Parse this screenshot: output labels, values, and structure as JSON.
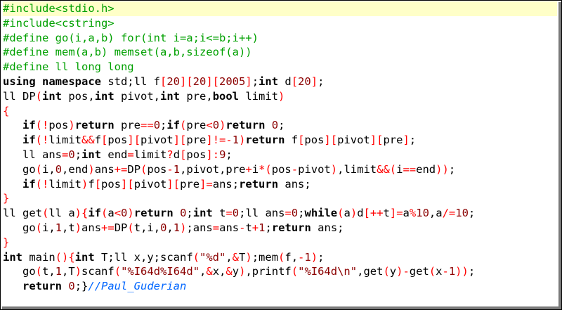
{
  "colors": {
    "preprocessor": "#00a000",
    "keyword": "#000000",
    "operator": "#ff0000",
    "number": "#8b0000",
    "string": "#8b0000",
    "comment": "#0066ff",
    "current_line": "#ffffc8"
  },
  "code": {
    "current_line_index": 0,
    "lines": [
      [
        [
          "pp",
          "#include<stdio.h>"
        ]
      ],
      [
        [
          "pp",
          "#include<cstring>"
        ]
      ],
      [
        [
          "pp",
          "#define go(i,a,b) for(int i=a;i<=b;i++)"
        ]
      ],
      [
        [
          "pp",
          "#define mem(a,b) memset(a,b,sizeof(a))"
        ]
      ],
      [
        [
          "pp",
          "#define ll long long"
        ]
      ],
      [
        [
          "kw",
          "using namespace"
        ],
        [
          "id",
          " std;ll f"
        ],
        [
          "op",
          "["
        ],
        [
          "num",
          "20"
        ],
        [
          "op",
          "]["
        ],
        [
          "num",
          "20"
        ],
        [
          "op",
          "]["
        ],
        [
          "num",
          "2005"
        ],
        [
          "op",
          "]"
        ],
        [
          "id",
          ";"
        ],
        [
          "kw",
          "int"
        ],
        [
          "id",
          " d"
        ],
        [
          "op",
          "["
        ],
        [
          "num",
          "20"
        ],
        [
          "op",
          "]"
        ],
        [
          "id",
          ";"
        ]
      ],
      [
        [
          "id",
          "ll DP"
        ],
        [
          "op",
          "("
        ],
        [
          "kw",
          "int"
        ],
        [
          "id",
          " pos,"
        ],
        [
          "kw",
          "int"
        ],
        [
          "id",
          " pivot,"
        ],
        [
          "kw",
          "int"
        ],
        [
          "id",
          " pre,"
        ],
        [
          "kw",
          "bool"
        ],
        [
          "id",
          " limit"
        ],
        [
          "op",
          ")"
        ]
      ],
      [
        [
          "op",
          "{"
        ]
      ],
      [
        [
          "id",
          "   "
        ],
        [
          "kw",
          "if"
        ],
        [
          "op",
          "(!"
        ],
        [
          "id",
          "pos"
        ],
        [
          "op",
          ")"
        ],
        [
          "kw",
          "return"
        ],
        [
          "id",
          " pre"
        ],
        [
          "op",
          "=="
        ],
        [
          "num",
          "0"
        ],
        [
          "id",
          ";"
        ],
        [
          "kw",
          "if"
        ],
        [
          "op",
          "("
        ],
        [
          "id",
          "pre"
        ],
        [
          "op",
          "<"
        ],
        [
          "num",
          "0"
        ],
        [
          "op",
          ")"
        ],
        [
          "kw",
          "return"
        ],
        [
          "id",
          " "
        ],
        [
          "num",
          "0"
        ],
        [
          "id",
          ";"
        ]
      ],
      [
        [
          "id",
          "   "
        ],
        [
          "kw",
          "if"
        ],
        [
          "op",
          "(!"
        ],
        [
          "id",
          "limit"
        ],
        [
          "op",
          "&&"
        ],
        [
          "id",
          "f"
        ],
        [
          "op",
          "["
        ],
        [
          "id",
          "pos"
        ],
        [
          "op",
          "]["
        ],
        [
          "id",
          "pivot"
        ],
        [
          "op",
          "]["
        ],
        [
          "id",
          "pre"
        ],
        [
          "op",
          "]!=-"
        ],
        [
          "num",
          "1"
        ],
        [
          "op",
          ")"
        ],
        [
          "kw",
          "return"
        ],
        [
          "id",
          " f"
        ],
        [
          "op",
          "["
        ],
        [
          "id",
          "pos"
        ],
        [
          "op",
          "]["
        ],
        [
          "id",
          "pivot"
        ],
        [
          "op",
          "]["
        ],
        [
          "id",
          "pre"
        ],
        [
          "op",
          "]"
        ],
        [
          "id",
          ";"
        ]
      ],
      [
        [
          "id",
          "   ll ans"
        ],
        [
          "op",
          "="
        ],
        [
          "num",
          "0"
        ],
        [
          "id",
          ";"
        ],
        [
          "kw",
          "int"
        ],
        [
          "id",
          " end"
        ],
        [
          "op",
          "="
        ],
        [
          "id",
          "limit"
        ],
        [
          "op",
          "?"
        ],
        [
          "id",
          "d"
        ],
        [
          "op",
          "["
        ],
        [
          "id",
          "pos"
        ],
        [
          "op",
          "]:"
        ],
        [
          "num",
          "9"
        ],
        [
          "id",
          ";"
        ]
      ],
      [
        [
          "id",
          "   go"
        ],
        [
          "op",
          "("
        ],
        [
          "id",
          "i,"
        ],
        [
          "num",
          "0"
        ],
        [
          "id",
          ",end"
        ],
        [
          "op",
          ")"
        ],
        [
          "id",
          "ans"
        ],
        [
          "op",
          "+="
        ],
        [
          "id",
          "DP"
        ],
        [
          "op",
          "("
        ],
        [
          "id",
          "pos"
        ],
        [
          "op",
          "-"
        ],
        [
          "num",
          "1"
        ],
        [
          "id",
          ",pivot,pre"
        ],
        [
          "op",
          "+"
        ],
        [
          "id",
          "i"
        ],
        [
          "op",
          "*("
        ],
        [
          "id",
          "pos"
        ],
        [
          "op",
          "-"
        ],
        [
          "id",
          "pivot"
        ],
        [
          "op",
          ")"
        ],
        [
          "id",
          ",limit"
        ],
        [
          "op",
          "&&("
        ],
        [
          "id",
          "i"
        ],
        [
          "op",
          "=="
        ],
        [
          "id",
          "end"
        ],
        [
          "op",
          "))"
        ],
        [
          "id",
          ";"
        ]
      ],
      [
        [
          "id",
          "   "
        ],
        [
          "kw",
          "if"
        ],
        [
          "op",
          "(!"
        ],
        [
          "id",
          "limit"
        ],
        [
          "op",
          ")"
        ],
        [
          "id",
          "f"
        ],
        [
          "op",
          "["
        ],
        [
          "id",
          "pos"
        ],
        [
          "op",
          "]["
        ],
        [
          "id",
          "pivot"
        ],
        [
          "op",
          "]["
        ],
        [
          "id",
          "pre"
        ],
        [
          "op",
          "]="
        ],
        [
          "id",
          "ans;"
        ],
        [
          "kw",
          "return"
        ],
        [
          "id",
          " ans;"
        ]
      ],
      [
        [
          "op",
          "}"
        ]
      ],
      [
        [
          "id",
          "ll get"
        ],
        [
          "op",
          "("
        ],
        [
          "id",
          "ll a"
        ],
        [
          "op",
          "){"
        ],
        [
          "kw",
          "if"
        ],
        [
          "op",
          "("
        ],
        [
          "id",
          "a"
        ],
        [
          "op",
          "<"
        ],
        [
          "num",
          "0"
        ],
        [
          "op",
          ")"
        ],
        [
          "kw",
          "return"
        ],
        [
          "id",
          " "
        ],
        [
          "num",
          "0"
        ],
        [
          "id",
          ";"
        ],
        [
          "kw",
          "int"
        ],
        [
          "id",
          " t"
        ],
        [
          "op",
          "="
        ],
        [
          "num",
          "0"
        ],
        [
          "id",
          ";ll ans"
        ],
        [
          "op",
          "="
        ],
        [
          "num",
          "0"
        ],
        [
          "id",
          ";"
        ],
        [
          "kw",
          "while"
        ],
        [
          "op",
          "("
        ],
        [
          "id",
          "a"
        ],
        [
          "op",
          ")"
        ],
        [
          "id",
          "d"
        ],
        [
          "op",
          "[++"
        ],
        [
          "id",
          "t"
        ],
        [
          "op",
          "]="
        ],
        [
          "id",
          "a"
        ],
        [
          "op",
          "%"
        ],
        [
          "num",
          "10"
        ],
        [
          "id",
          ",a"
        ],
        [
          "op",
          "/="
        ],
        [
          "num",
          "10"
        ],
        [
          "id",
          ";"
        ]
      ],
      [
        [
          "id",
          "   go"
        ],
        [
          "op",
          "("
        ],
        [
          "id",
          "i,"
        ],
        [
          "num",
          "1"
        ],
        [
          "id",
          ",t"
        ],
        [
          "op",
          ")"
        ],
        [
          "id",
          "ans"
        ],
        [
          "op",
          "+="
        ],
        [
          "id",
          "DP"
        ],
        [
          "op",
          "("
        ],
        [
          "id",
          "t,i,"
        ],
        [
          "num",
          "0"
        ],
        [
          "id",
          ","
        ],
        [
          "num",
          "1"
        ],
        [
          "op",
          ")"
        ],
        [
          "id",
          ";ans"
        ],
        [
          "op",
          "="
        ],
        [
          "id",
          "ans"
        ],
        [
          "op",
          "-"
        ],
        [
          "id",
          "t"
        ],
        [
          "op",
          "+"
        ],
        [
          "num",
          "1"
        ],
        [
          "id",
          ";"
        ],
        [
          "kw",
          "return"
        ],
        [
          "id",
          " ans;"
        ]
      ],
      [
        [
          "op",
          "}"
        ]
      ],
      [
        [
          "kw",
          "int"
        ],
        [
          "id",
          " main"
        ],
        [
          "op",
          "(){"
        ],
        [
          "kw",
          "int"
        ],
        [
          "id",
          " T;ll x,y;scanf"
        ],
        [
          "op",
          "("
        ],
        [
          "str",
          "\"%d\""
        ],
        [
          "id",
          ","
        ],
        [
          "op",
          "&"
        ],
        [
          "id",
          "T"
        ],
        [
          "op",
          ")"
        ],
        [
          "id",
          ";mem"
        ],
        [
          "op",
          "("
        ],
        [
          "id",
          "f,"
        ],
        [
          "op",
          "-"
        ],
        [
          "num",
          "1"
        ],
        [
          "op",
          ")"
        ],
        [
          "id",
          ";"
        ]
      ],
      [
        [
          "id",
          "   go"
        ],
        [
          "op",
          "("
        ],
        [
          "id",
          "t,"
        ],
        [
          "num",
          "1"
        ],
        [
          "id",
          ",T"
        ],
        [
          "op",
          ")"
        ],
        [
          "id",
          "scanf"
        ],
        [
          "op",
          "("
        ],
        [
          "str",
          "\"%I64d%I64d\""
        ],
        [
          "id",
          ","
        ],
        [
          "op",
          "&"
        ],
        [
          "id",
          "x,"
        ],
        [
          "op",
          "&"
        ],
        [
          "id",
          "y"
        ],
        [
          "op",
          ")"
        ],
        [
          "id",
          ",printf"
        ],
        [
          "op",
          "("
        ],
        [
          "str",
          "\"%I64d\\n\""
        ],
        [
          "id",
          ",get"
        ],
        [
          "op",
          "("
        ],
        [
          "id",
          "y"
        ],
        [
          "op",
          ")-"
        ],
        [
          "id",
          "get"
        ],
        [
          "op",
          "("
        ],
        [
          "id",
          "x"
        ],
        [
          "op",
          "-"
        ],
        [
          "num",
          "1"
        ],
        [
          "op",
          "))"
        ],
        [
          "id",
          ";"
        ]
      ],
      [
        [
          "id",
          "   "
        ],
        [
          "kw",
          "return"
        ],
        [
          "id",
          " "
        ],
        [
          "num",
          "0"
        ],
        [
          "id",
          ";}"
        ],
        [
          "cm",
          "//Paul_Guderian"
        ]
      ]
    ]
  }
}
